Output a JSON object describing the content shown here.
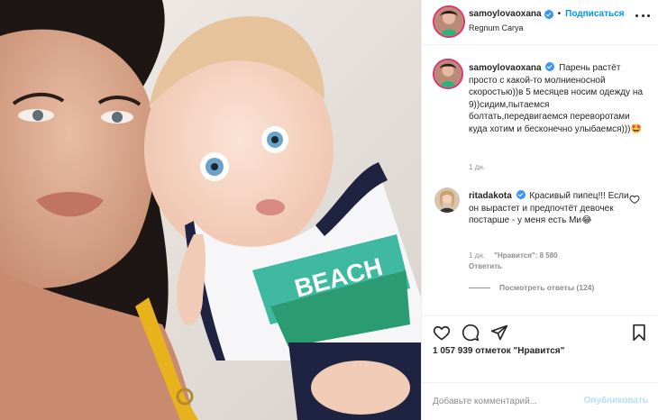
{
  "photo": {
    "alt": ""
  },
  "header": {
    "username": "samoylovaoxana",
    "separator": "•",
    "follow_label": "Подписаться",
    "location": "Regnum Carya"
  },
  "caption": {
    "username": "samoylovaoxana",
    "text": "Парень растёт просто с какой-то молниеносной скоростью))в 5 месяцев носим одежду на 9))сидим,пытаемся болтать,передвигаемся переворотами куда хотим и бесконечно улыбаемся)))🤩",
    "time": "1 дн."
  },
  "comment": {
    "username": "ritadakota",
    "text": "Красивый пипец!!! Если он вырастет и предпочтёт девочек постарше - у меня есть Ми😂",
    "time": "1 дн.",
    "likes": "\"Нравится\": 8 580",
    "reply_label": "Ответить",
    "view_replies": "Посмотреть ответы (124)"
  },
  "likes_text": "1 057 939 отметок \"Нравится\"",
  "add_comment": {
    "placeholder": "Добавьте комментарий...",
    "publish_label": "Опубликовать"
  },
  "colors": {
    "accent": "#0095f6",
    "verified": "#3897f0",
    "muted": "#8e8e8e",
    "publish_disabled": "#b2dffc"
  },
  "icons": [
    "heart-icon",
    "comment-icon",
    "share-icon",
    "bookmark-icon",
    "more-icon",
    "verified-icon"
  ]
}
